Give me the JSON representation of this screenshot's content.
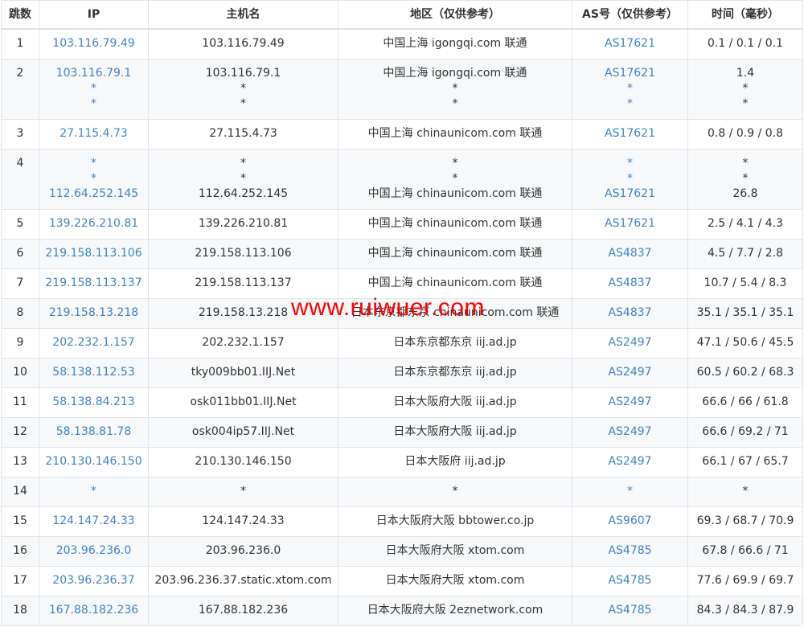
{
  "headers": {
    "hop": "跳数",
    "ip": "IP",
    "host": "主机名",
    "region": "地区（仅供参考）",
    "asn": "AS号（仅供参考）",
    "time": "时间（毫秒）"
  },
  "rows": [
    {
      "hop": "1",
      "ip": [
        "103.116.79.49"
      ],
      "host": [
        "103.116.79.49"
      ],
      "region": [
        "中国上海 igongqi.com 联通"
      ],
      "asn": [
        "AS17621"
      ],
      "time": [
        "0.1 / 0.1 / 0.1"
      ]
    },
    {
      "hop": "2",
      "ip": [
        "103.116.79.1",
        "*",
        "*"
      ],
      "host": [
        "103.116.79.1",
        "*",
        "*"
      ],
      "region": [
        "中国上海 igongqi.com 联通",
        "*",
        "*"
      ],
      "asn": [
        "AS17621",
        "*",
        "*"
      ],
      "time": [
        "1.4",
        "*",
        "*"
      ]
    },
    {
      "hop": "3",
      "ip": [
        "27.115.4.73"
      ],
      "host": [
        "27.115.4.73"
      ],
      "region": [
        "中国上海 chinaunicom.com 联通"
      ],
      "asn": [
        "AS17621"
      ],
      "time": [
        "0.8 / 0.9 / 0.8"
      ]
    },
    {
      "hop": "4",
      "ip": [
        "*",
        "*",
        "112.64.252.145"
      ],
      "host": [
        "*",
        "*",
        "112.64.252.145"
      ],
      "region": [
        "*",
        "*",
        "中国上海 chinaunicom.com 联通"
      ],
      "asn": [
        "*",
        "*",
        "AS17621"
      ],
      "time": [
        "*",
        "*",
        "26.8"
      ]
    },
    {
      "hop": "5",
      "ip": [
        "139.226.210.81"
      ],
      "host": [
        "139.226.210.81"
      ],
      "region": [
        "中国上海 chinaunicom.com 联通"
      ],
      "asn": [
        "AS17621"
      ],
      "time": [
        "2.5 / 4.1 / 4.3"
      ]
    },
    {
      "hop": "6",
      "ip": [
        "219.158.113.106"
      ],
      "host": [
        "219.158.113.106"
      ],
      "region": [
        "中国上海 chinaunicom.com 联通"
      ],
      "asn": [
        "AS4837"
      ],
      "time": [
        "4.5 / 7.7 / 2.8"
      ]
    },
    {
      "hop": "7",
      "ip": [
        "219.158.113.137"
      ],
      "host": [
        "219.158.113.137"
      ],
      "region": [
        "中国上海 chinaunicom.com 联通"
      ],
      "asn": [
        "AS4837"
      ],
      "time": [
        "10.7 / 5.4 / 8.3"
      ]
    },
    {
      "hop": "8",
      "ip": [
        "219.158.13.218"
      ],
      "host": [
        "219.158.13.218"
      ],
      "region": [
        "日本东京都东京 chinaunicom.com 联通"
      ],
      "asn": [
        "AS4837"
      ],
      "time": [
        "35.1 / 35.1 / 35.1"
      ]
    },
    {
      "hop": "9",
      "ip": [
        "202.232.1.157"
      ],
      "host": [
        "202.232.1.157"
      ],
      "region": [
        "日本东京都东京 iij.ad.jp"
      ],
      "asn": [
        "AS2497"
      ],
      "time": [
        "47.1 / 50.6 / 45.5"
      ]
    },
    {
      "hop": "10",
      "ip": [
        "58.138.112.53"
      ],
      "host": [
        "tky009bb01.IIJ.Net"
      ],
      "region": [
        "日本东京都东京 iij.ad.jp"
      ],
      "asn": [
        "AS2497"
      ],
      "time": [
        "60.5 / 60.2 / 68.3"
      ]
    },
    {
      "hop": "11",
      "ip": [
        "58.138.84.213"
      ],
      "host": [
        "osk011bb01.IIJ.Net"
      ],
      "region": [
        "日本大阪府大阪 iij.ad.jp"
      ],
      "asn": [
        "AS2497"
      ],
      "time": [
        "66.6 / 66 / 61.8"
      ]
    },
    {
      "hop": "12",
      "ip": [
        "58.138.81.78"
      ],
      "host": [
        "osk004ip57.IIJ.Net"
      ],
      "region": [
        "日本大阪府大阪 iij.ad.jp"
      ],
      "asn": [
        "AS2497"
      ],
      "time": [
        "66.6 / 69.2 / 71"
      ]
    },
    {
      "hop": "13",
      "ip": [
        "210.130.146.150"
      ],
      "host": [
        "210.130.146.150"
      ],
      "region": [
        "日本大阪府 iij.ad.jp"
      ],
      "asn": [
        "AS2497"
      ],
      "time": [
        "66.1 / 67 / 65.7"
      ]
    },
    {
      "hop": "14",
      "ip": [
        "*"
      ],
      "host": [
        "*"
      ],
      "region": [
        "*"
      ],
      "asn": [
        "*"
      ],
      "time": [
        "*"
      ]
    },
    {
      "hop": "15",
      "ip": [
        "124.147.24.33"
      ],
      "host": [
        "124.147.24.33"
      ],
      "region": [
        "日本大阪府大阪 bbtower.co.jp"
      ],
      "asn": [
        "AS9607"
      ],
      "time": [
        "69.3 / 68.7 / 70.9"
      ]
    },
    {
      "hop": "16",
      "ip": [
        "203.96.236.0"
      ],
      "host": [
        "203.96.236.0"
      ],
      "region": [
        "日本大阪府大阪 xtom.com"
      ],
      "asn": [
        "AS4785"
      ],
      "time": [
        "67.8 / 66.6 / 71"
      ]
    },
    {
      "hop": "17",
      "ip": [
        "203.96.236.37"
      ],
      "host": [
        "203.96.236.37.static.xtom.com"
      ],
      "region": [
        "日本大阪府大阪 xtom.com"
      ],
      "asn": [
        "AS4785"
      ],
      "time": [
        "77.6 / 69.9 / 69.7"
      ]
    },
    {
      "hop": "18",
      "ip": [
        "167.88.182.236"
      ],
      "host": [
        "167.88.182.236"
      ],
      "region": [
        "日本大阪府大阪 2eznetwork.com"
      ],
      "asn": [
        "AS4785"
      ],
      "time": [
        "84.3 / 84.3 / 87.9"
      ]
    }
  ],
  "watermark": "www.ruiwuer.com",
  "colors": {
    "link": "#4183c4",
    "text": "#333333",
    "stripe": "#f6f8fa",
    "border": "#e1e4e8",
    "watermark": "#ff0000"
  }
}
